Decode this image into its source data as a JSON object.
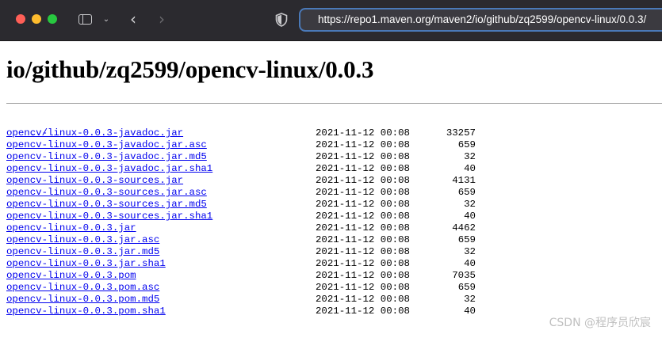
{
  "browser": {
    "url": "https://repo1.maven.org/maven2/io/github/zq2599/opencv-linux/0.0.3/",
    "traffic_colors": {
      "close": "#ff5f57",
      "minimize": "#febc2e",
      "zoom": "#28c840"
    },
    "icons": {
      "sidebar": "sidebar-icon",
      "chevron": "chevron-down-icon",
      "back": "chevron-left-icon",
      "forward": "chevron-right-icon",
      "privacy": "shield-icon"
    },
    "glyphs": {
      "chevron": "⌄",
      "back": "‹",
      "forward": "›"
    }
  },
  "page": {
    "title": "io/github/zq2599/opencv-linux/0.0.3",
    "parent_link": "../",
    "link_color": "#0000ee",
    "files": [
      {
        "name": "opencv-linux-0.0.3-javadoc.jar",
        "date": "2021-11-12 00:08",
        "size": "33257"
      },
      {
        "name": "opencv-linux-0.0.3-javadoc.jar.asc",
        "date": "2021-11-12 00:08",
        "size": "659"
      },
      {
        "name": "opencv-linux-0.0.3-javadoc.jar.md5",
        "date": "2021-11-12 00:08",
        "size": "32"
      },
      {
        "name": "opencv-linux-0.0.3-javadoc.jar.sha1",
        "date": "2021-11-12 00:08",
        "size": "40"
      },
      {
        "name": "opencv-linux-0.0.3-sources.jar",
        "date": "2021-11-12 00:08",
        "size": "4131"
      },
      {
        "name": "opencv-linux-0.0.3-sources.jar.asc",
        "date": "2021-11-12 00:08",
        "size": "659"
      },
      {
        "name": "opencv-linux-0.0.3-sources.jar.md5",
        "date": "2021-11-12 00:08",
        "size": "32"
      },
      {
        "name": "opencv-linux-0.0.3-sources.jar.sha1",
        "date": "2021-11-12 00:08",
        "size": "40"
      },
      {
        "name": "opencv-linux-0.0.3.jar",
        "date": "2021-11-12 00:08",
        "size": "4462"
      },
      {
        "name": "opencv-linux-0.0.3.jar.asc",
        "date": "2021-11-12 00:08",
        "size": "659"
      },
      {
        "name": "opencv-linux-0.0.3.jar.md5",
        "date": "2021-11-12 00:08",
        "size": "32"
      },
      {
        "name": "opencv-linux-0.0.3.jar.sha1",
        "date": "2021-11-12 00:08",
        "size": "40"
      },
      {
        "name": "opencv-linux-0.0.3.pom",
        "date": "2021-11-12 00:08",
        "size": "7035"
      },
      {
        "name": "opencv-linux-0.0.3.pom.asc",
        "date": "2021-11-12 00:08",
        "size": "659"
      },
      {
        "name": "opencv-linux-0.0.3.pom.md5",
        "date": "2021-11-12 00:08",
        "size": "32"
      },
      {
        "name": "opencv-linux-0.0.3.pom.sha1",
        "date": "2021-11-12 00:08",
        "size": "40"
      }
    ]
  },
  "watermark": "CSDN @程序员欣宸"
}
